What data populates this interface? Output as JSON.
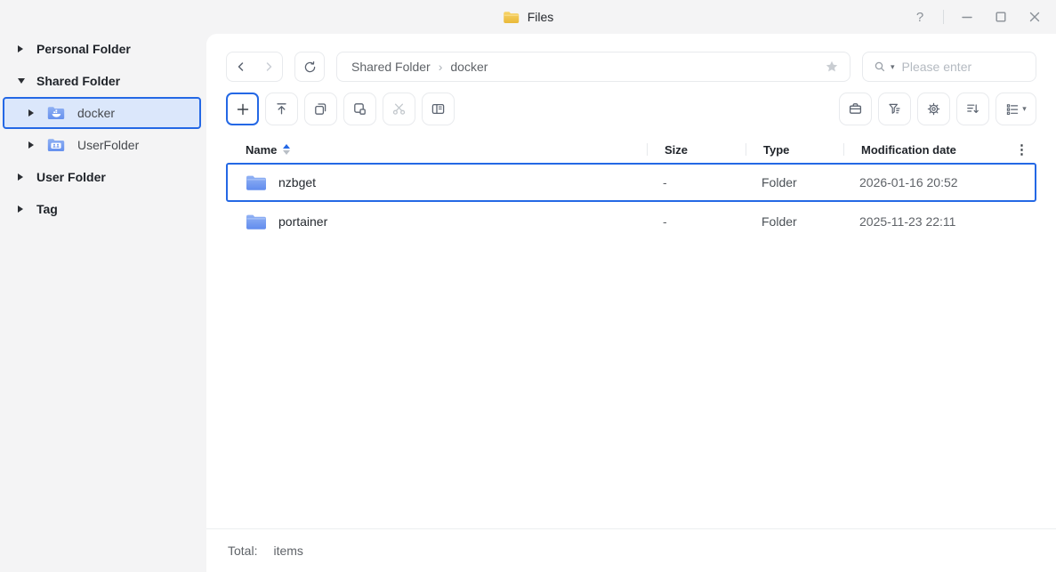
{
  "titlebar": {
    "title": "Files"
  },
  "icons": {
    "help": "?",
    "breadcrumb_separator": "›",
    "dots_menu": "⋮",
    "caret_down": "▾"
  },
  "colors": {
    "accent": "#2468e5",
    "selected_bg": "#dbe7fb",
    "folder_blue": "#6b97ef",
    "folder_yellow": "#f0c04b",
    "panel_bg": "#ffffff",
    "page_bg": "#f4f4f5"
  },
  "sidebar": {
    "items": [
      {
        "label": "Personal Folder",
        "expanded": false
      },
      {
        "label": "Shared Folder",
        "expanded": true
      },
      {
        "label": "docker",
        "selected": true,
        "icon": "docker-folder"
      },
      {
        "label": "UserFolder",
        "selected": false,
        "icon": "users-folder"
      },
      {
        "label": "User Folder",
        "expanded": false
      },
      {
        "label": "Tag",
        "expanded": false
      }
    ]
  },
  "nav": {
    "breadcrumb_parent": "Shared Folder",
    "breadcrumb_current": "docker",
    "search_placeholder": "Please enter"
  },
  "table": {
    "columns": {
      "name": "Name",
      "size": "Size",
      "type": "Type",
      "modified": "Modification date"
    },
    "rows": [
      {
        "name": "nzbget",
        "size": "-",
        "type": "Folder",
        "modified": "2026-01-16 20:52",
        "selected": true
      },
      {
        "name": "portainer",
        "size": "-",
        "type": "Folder",
        "modified": "2025-11-23 22:11",
        "selected": false
      }
    ]
  },
  "statusbar": {
    "total_label": "Total:",
    "items_label": "items"
  }
}
